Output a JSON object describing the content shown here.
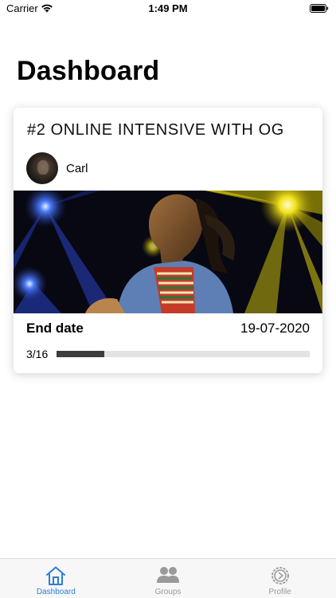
{
  "status_bar": {
    "carrier": "Carrier",
    "time": "1:49 PM"
  },
  "header": {
    "title": "Dashboard"
  },
  "course_card": {
    "title": "#2 ONLINE INTENSIVE WITH OG",
    "author": "Carl",
    "end_label": "End date",
    "end_date": "19-07-2020",
    "progress_text": "3/16",
    "progress_fraction": 0.1875
  },
  "tab_bar": {
    "tabs": [
      {
        "label": "Dashboard",
        "icon": "home-icon",
        "active": true
      },
      {
        "label": "Groups",
        "icon": "groups-icon",
        "active": false
      },
      {
        "label": "Profile",
        "icon": "profile-gear-icon",
        "active": false
      }
    ]
  },
  "colors": {
    "accent": "#2b7ed6",
    "inactive": "#999999",
    "progress_fill": "#3d3d3d",
    "progress_track": "#e3e3e3"
  }
}
